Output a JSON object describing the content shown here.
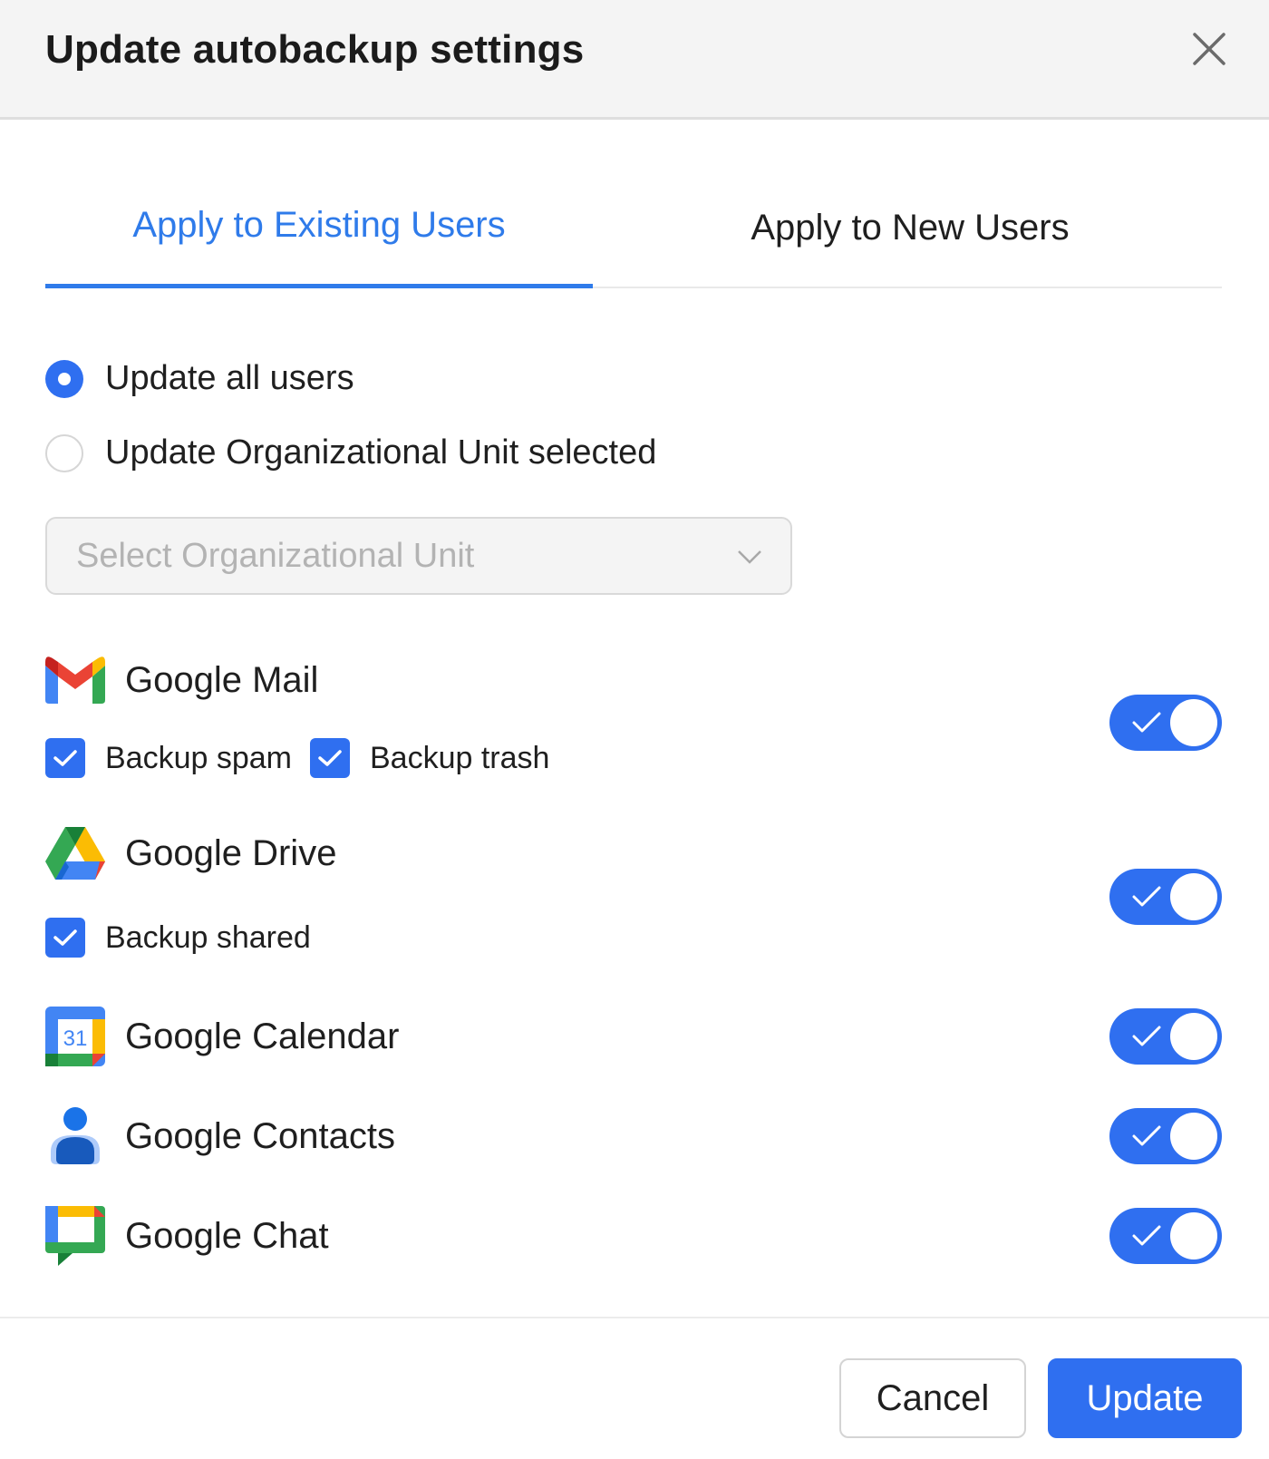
{
  "dialog": {
    "title": "Update autobackup settings"
  },
  "tabs": [
    {
      "label": "Apply to Existing Users",
      "active": true
    },
    {
      "label": "Apply to New Users",
      "active": false
    }
  ],
  "scope": {
    "options": [
      {
        "label": "Update all users",
        "selected": true
      },
      {
        "label": "Update Organizational Unit selected",
        "selected": false
      }
    ],
    "ou_select": {
      "placeholder": "Select Organizational Unit"
    }
  },
  "services": [
    {
      "label": "Google Mail",
      "icon": "gmail-icon",
      "enabled": true,
      "options": [
        {
          "label": "Backup spam",
          "checked": true
        },
        {
          "label": "Backup trash",
          "checked": true
        }
      ]
    },
    {
      "label": "Google Drive",
      "icon": "google-drive-icon",
      "enabled": true,
      "options": [
        {
          "label": "Backup shared",
          "checked": true
        }
      ]
    },
    {
      "label": "Google Calendar",
      "icon": "google-calendar-icon",
      "icon_text": "31",
      "enabled": true,
      "options": []
    },
    {
      "label": "Google Contacts",
      "icon": "google-contacts-icon",
      "enabled": true,
      "options": []
    },
    {
      "label": "Google Chat",
      "icon": "google-chat-icon",
      "enabled": true,
      "options": []
    }
  ],
  "footer": {
    "cancel_label": "Cancel",
    "update_label": "Update"
  },
  "colors": {
    "accent": "#2f6ff0",
    "tab_active": "#2f7bea",
    "header_bg": "#f4f4f4"
  }
}
